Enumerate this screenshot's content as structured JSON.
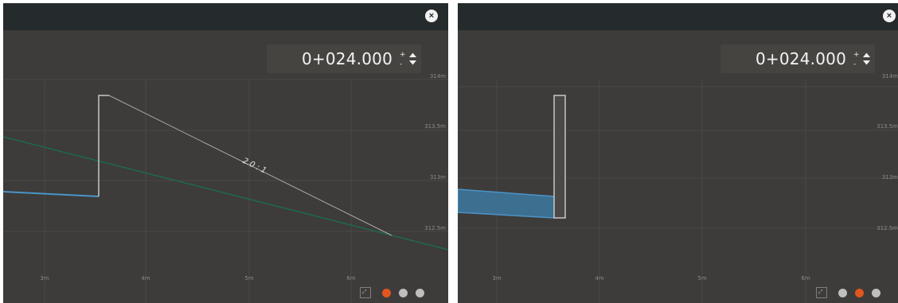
{
  "panels": [
    {
      "close_label": "×",
      "station_value": "0+024.000",
      "y_ticks": [
        "314m",
        "313.5m",
        "313m",
        "312.5m"
      ],
      "x_ticks": [
        "3m",
        "4m",
        "5m",
        "6m"
      ],
      "slope_label": "2.0 : 1",
      "active_page": 1,
      "colors": {
        "cut_line": "#c7c7c5",
        "wall": "#c7c7c5",
        "ground": "#1e6a4a",
        "pavement": "#4a94c7"
      }
    },
    {
      "close_label": "×",
      "station_value": "0+024.000",
      "y_ticks": [
        "314m",
        "313.5m",
        "313m",
        "312.5m"
      ],
      "x_ticks": [
        "3m",
        "4m",
        "5m",
        "6m"
      ],
      "active_page": 2,
      "colors": {
        "wall": "#c7c7c5",
        "pavement_fill": "#3d7aa3",
        "pavement": "#4a94c7"
      }
    }
  ],
  "icons": {
    "close": "close-icon",
    "stepper": "stepper-arrows-icon",
    "fit": "fit-view-icon"
  }
}
